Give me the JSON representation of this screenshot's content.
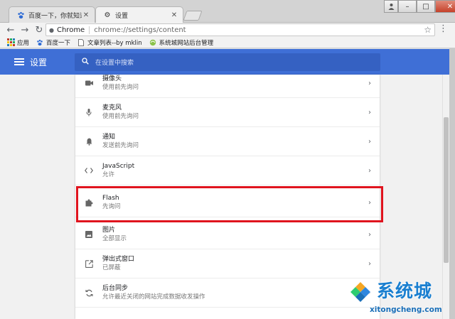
{
  "tabs": [
    {
      "label": "百度一下，你就知道",
      "icon": "baidu-paw-icon",
      "active": false
    },
    {
      "label": "设置",
      "icon": "gear-icon",
      "active": true
    }
  ],
  "window_controls": {
    "minimize": "–",
    "maximize": "□",
    "close": "✕"
  },
  "toolbar": {
    "host": "Chrome",
    "url": "chrome://settings/content"
  },
  "bookmarks": [
    {
      "label": "应用",
      "icon": "apps-grid-icon"
    },
    {
      "label": "百度一下",
      "icon": "baidu-paw-icon"
    },
    {
      "label": "文章列表--by mklin",
      "icon": "page-icon"
    },
    {
      "label": "系统城网站后台管理",
      "icon": "site-globe-icon"
    }
  ],
  "header": {
    "title": "设置",
    "search_placeholder": "在设置中搜索"
  },
  "settings_rows": [
    {
      "name": "摄像头",
      "sub": "使用前先询问",
      "icon": "camera-icon"
    },
    {
      "name": "麦克风",
      "sub": "使用前先询问",
      "icon": "microphone-icon"
    },
    {
      "name": "通知",
      "sub": "发送前先询问",
      "icon": "bell-icon"
    },
    {
      "name": "JavaScript",
      "sub": "允许",
      "icon": "code-brackets-icon"
    },
    {
      "name": "Flash",
      "sub": "先询问",
      "icon": "puzzle-icon"
    },
    {
      "name": "图片",
      "sub": "全部显示",
      "icon": "image-icon"
    },
    {
      "name": "弹出式窗口",
      "sub": "已屏蔽",
      "icon": "popup-icon"
    },
    {
      "name": "后台同步",
      "sub": "允许最近关闭的网站完成数据收发操作",
      "icon": "sync-icon"
    }
  ],
  "watermark": {
    "brand": "系统城",
    "url": "xitongcheng.com"
  },
  "colors": {
    "header_blue": "#3f6fd6",
    "highlight_red": "#e0141e"
  }
}
